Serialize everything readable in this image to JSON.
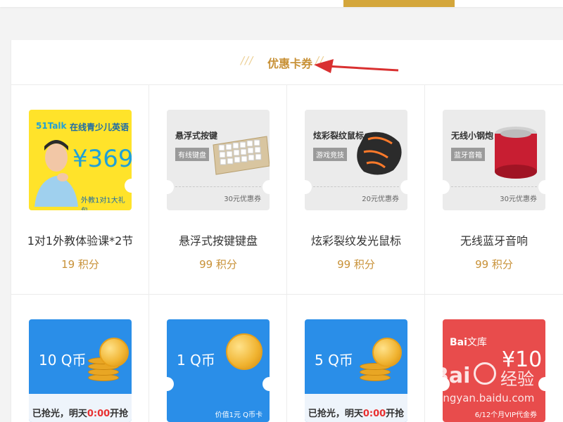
{
  "section": {
    "title": "优惠卡券",
    "left_deco": "///",
    "right_deco": "//"
  },
  "products": [
    {
      "name": "1对1外教体验课*2节",
      "points": "19 积分",
      "card": {
        "brand": "51Talk",
        "slogan": "在线青少儿英语",
        "price": "¥369",
        "footer": "外教1对1大礼包"
      }
    },
    {
      "name": "悬浮式按键键盘",
      "points": "99 积分",
      "card": {
        "title": "悬浮式按键",
        "tag": "有线键盘",
        "coupon": "30元优惠券"
      }
    },
    {
      "name": "炫彩裂纹发光鼠标",
      "points": "99 积分",
      "card": {
        "title": "炫彩裂纹鼠标",
        "tag": "游戏竞技",
        "coupon": "20元优惠券"
      }
    },
    {
      "name": "无线蓝牙音响",
      "points": "99 积分",
      "card": {
        "title": "无线小钢炮",
        "tag": "蓝牙音箱",
        "coupon": "30元优惠券"
      }
    }
  ],
  "qcards": [
    {
      "amount": "10 Q币",
      "status_prefix": "已抢光，明天",
      "status_time": "0:00",
      "status_suffix": "开抢"
    },
    {
      "amount": "1 Q币",
      "note": "价值1元 Q币卡"
    },
    {
      "amount": "5 Q币",
      "status_prefix": "已抢光，明天",
      "status_time": "0:00",
      "status_suffix": "开抢"
    },
    {
      "brand": "Bai",
      "brand2": "文库",
      "price": "¥10",
      "footer": "6/12个月VIP代金券"
    }
  ],
  "watermark": {
    "line1": "Bai",
    "line2": "经验",
    "url": "jingyan.baidu.com"
  },
  "colors": {
    "accent": "#c89137",
    "tab": "#d4a63b",
    "blue": "#2a8ee8",
    "red": "#e84c4c",
    "yellow": "#ffe32a"
  }
}
